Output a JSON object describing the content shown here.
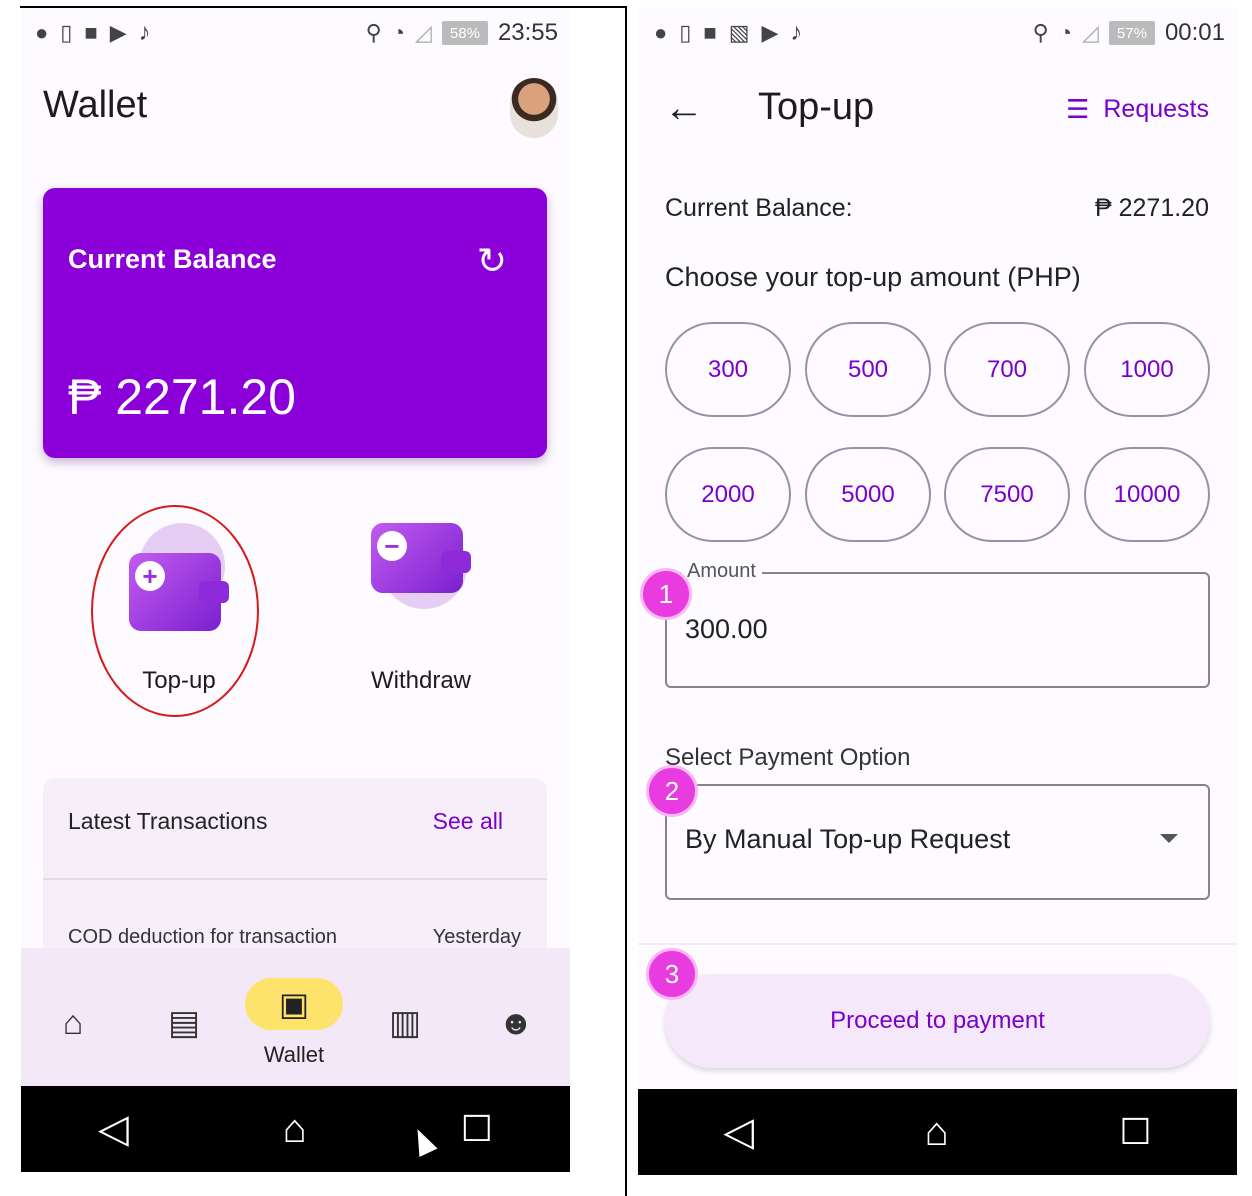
{
  "left_screen": {
    "status": {
      "battery": "58%",
      "time": "23:55"
    },
    "title": "Wallet",
    "balance_card": {
      "label": "Current Balance",
      "amount": "₱ 2271.20"
    },
    "actions": [
      {
        "label": "Top-up"
      },
      {
        "label": "Withdraw"
      }
    ],
    "transactions": {
      "title": "Latest Transactions",
      "see_all": "See all",
      "items": [
        {
          "description": "COD deduction for transaction",
          "date": "Yesterday"
        }
      ]
    },
    "bottom_nav": {
      "active_label": "Wallet"
    }
  },
  "right_screen": {
    "status": {
      "battery": "57%",
      "time": "00:01"
    },
    "title": "Top-up",
    "requests_label": "Requests",
    "current_balance": {
      "label": "Current Balance:",
      "value": "₱ 2271.20"
    },
    "choose_label": "Choose your top-up amount (PHP)",
    "amounts": [
      "300",
      "500",
      "700",
      "1000",
      "2000",
      "5000",
      "7500",
      "10000"
    ],
    "amount_field": {
      "label": "Amount",
      "value": "300.00"
    },
    "payment": {
      "label": "Select Payment Option",
      "selected": "By Manual Top-up Request"
    },
    "proceed_label": "Proceed to payment",
    "step_badges": [
      "1",
      "2",
      "3"
    ]
  },
  "colors": {
    "accent": "#8b00d8",
    "nav_active": "#fde36b",
    "badge": "#e83ce0",
    "highlight": "#d71a1a"
  }
}
